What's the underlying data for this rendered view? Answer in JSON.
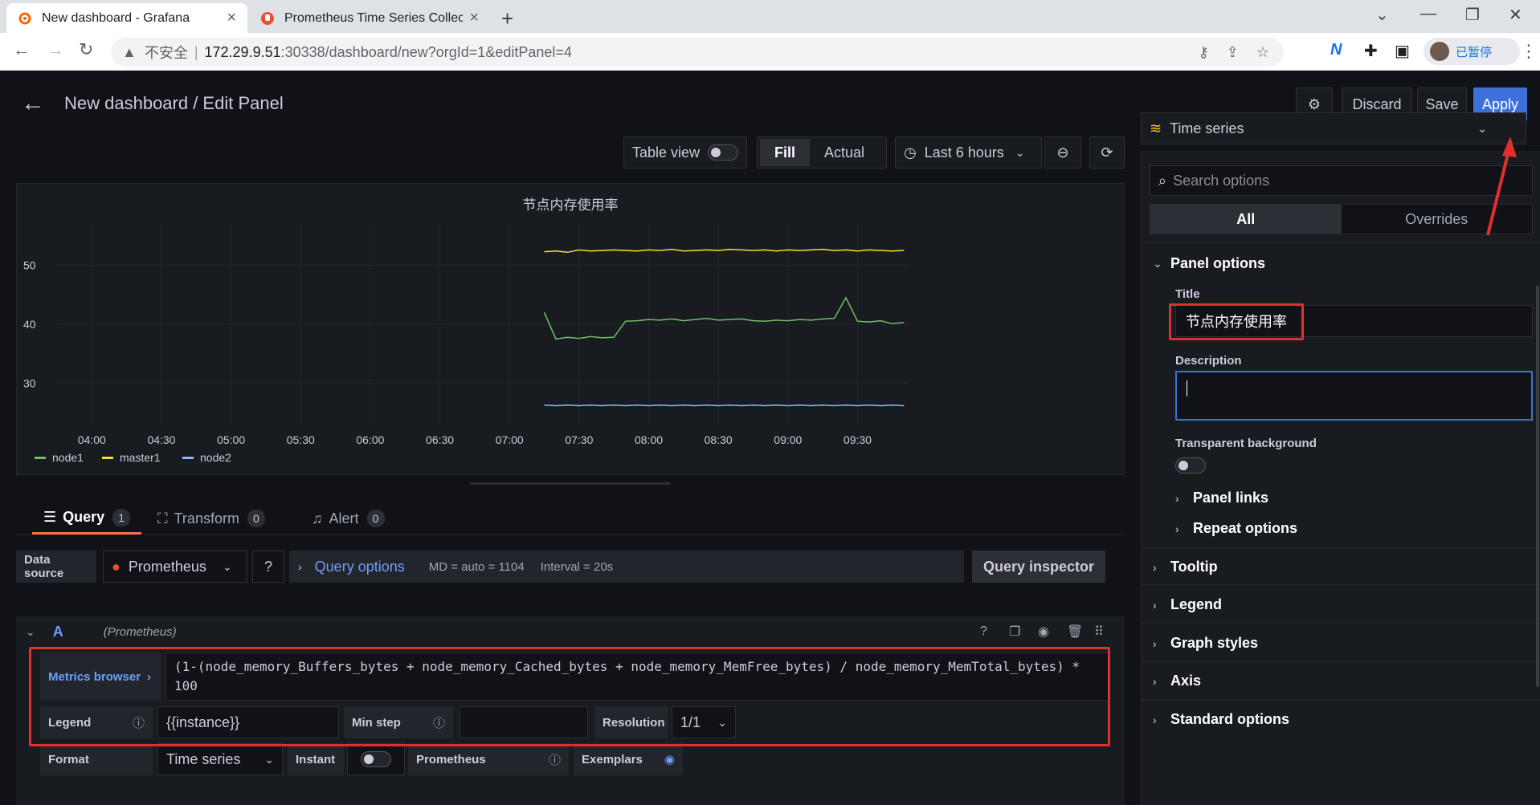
{
  "browser": {
    "tabs": [
      {
        "label": "New dashboard - Grafana",
        "icon": "grafana-icon"
      },
      {
        "label": "Prometheus Time Series Collec",
        "icon": "prometheus-icon"
      }
    ],
    "url": {
      "insecure_label": "不安全",
      "separator": "|",
      "host": "172.29.9.51",
      "path": ":30338/dashboard/new?orgId=1&editPanel=4"
    },
    "profile_label": "已暂停"
  },
  "header": {
    "title": "New dashboard / Edit Panel",
    "discard": "Discard",
    "save": "Save",
    "apply": "Apply"
  },
  "toolbar": {
    "table_view": "Table view",
    "fill": "Fill",
    "actual": "Actual",
    "time_range": "Last 6 hours"
  },
  "visualization": {
    "selected": "Time series"
  },
  "panel": {
    "title": "节点内存使用率"
  },
  "chart_data": {
    "type": "line",
    "x": [
      "07:15",
      "07:20",
      "07:25",
      "07:30",
      "07:35",
      "07:40",
      "07:45",
      "07:50",
      "07:55",
      "08:00",
      "08:05",
      "08:10",
      "08:15",
      "08:20",
      "08:25",
      "08:30",
      "08:35",
      "08:40",
      "08:45",
      "08:50",
      "08:55",
      "09:00",
      "09:05",
      "09:10",
      "09:15",
      "09:20",
      "09:25",
      "09:30",
      "09:35",
      "09:40",
      "09:45",
      "09:50"
    ],
    "series": [
      {
        "name": "node1",
        "color": "#73bf69",
        "values": [
          42,
          37.5,
          37.8,
          37.6,
          37.9,
          37.7,
          37.8,
          40.5,
          40.6,
          40.8,
          40.7,
          40.9,
          40.6,
          40.8,
          41,
          40.7,
          40.8,
          40.9,
          40.6,
          40.5,
          40.7,
          40.6,
          40.8,
          40.7,
          40.9,
          41,
          44.5,
          40.5,
          40.4,
          40.6,
          40.1,
          40.3
        ]
      },
      {
        "name": "master1",
        "color": "#fade2a",
        "values": [
          52.3,
          52.4,
          52.2,
          52.6,
          52.4,
          52.5,
          52.6,
          52.5,
          52.4,
          52.6,
          52.5,
          52.7,
          52.4,
          52.5,
          52.6,
          52.5,
          52.7,
          52.6,
          52.5,
          52.6,
          52.4,
          52.6,
          52.5,
          52.6,
          52.7,
          52.5,
          52.6,
          52.4,
          52.6,
          52.5,
          52.4,
          52.5
        ]
      },
      {
        "name": "node2",
        "color": "#8ab8ff",
        "values": [
          26.3,
          26.2,
          26.3,
          26.2,
          26.3,
          26.2,
          26.3,
          26.2,
          26.3,
          26.2,
          26.3,
          26.2,
          26.3,
          26.2,
          26.3,
          26.2,
          26.3,
          26.2,
          26.3,
          26.2,
          26.3,
          26.2,
          26.3,
          26.2,
          26.3,
          26.2,
          26.3,
          26.2,
          26.3,
          26.2,
          26.3,
          26.2
        ]
      }
    ],
    "x_ticks": [
      "04:00",
      "04:30",
      "05:00",
      "05:30",
      "06:00",
      "06:30",
      "07:00",
      "07:30",
      "08:00",
      "08:30",
      "09:00",
      "09:30"
    ],
    "y_ticks": [
      30,
      40,
      50
    ],
    "ylim": [
      23,
      57
    ],
    "grid": true,
    "legend": "bottom-left"
  },
  "query_tabs": [
    {
      "label": "Query",
      "count": "1"
    },
    {
      "label": "Transform",
      "count": "0"
    },
    {
      "label": "Alert",
      "count": "0"
    }
  ],
  "datasource": {
    "label": "Data source",
    "name": "Prometheus",
    "query_options": "Query options",
    "md": "MD = auto = 1104",
    "interval": "Interval = 20s",
    "inspector": "Query inspector"
  },
  "query": {
    "ref": "A",
    "source": "(Prometheus)",
    "metrics_browser": "Metrics browser",
    "expr_line1": "(1-(node_memory_Buffers_bytes + node_memory_Cached_bytes + node_memory_MemFree_bytes) / node_memory_MemTotal_bytes) *",
    "expr_line2": "100",
    "legend_label": "Legend",
    "legend_value": "{{instance}}",
    "min_step_label": "Min step",
    "resolution_label": "Resolution",
    "resolution_value": "1/1",
    "format_label": "Format",
    "format_value": "Time series",
    "instant_label": "Instant",
    "prometheus_label": "Prometheus",
    "exemplars_label": "Exemplars"
  },
  "options": {
    "search_placeholder": "Search options",
    "tab_all": "All",
    "tab_overrides": "Overrides",
    "panel_options": "Panel options",
    "title_label": "Title",
    "title_value": "节点内存使用率",
    "description_label": "Description",
    "transparent_label": "Transparent background",
    "panel_links": "Panel links",
    "repeat_options": "Repeat options",
    "tooltip": "Tooltip",
    "legend": "Legend",
    "graph_styles": "Graph styles",
    "axis": "Axis",
    "standard_options": "Standard options"
  }
}
